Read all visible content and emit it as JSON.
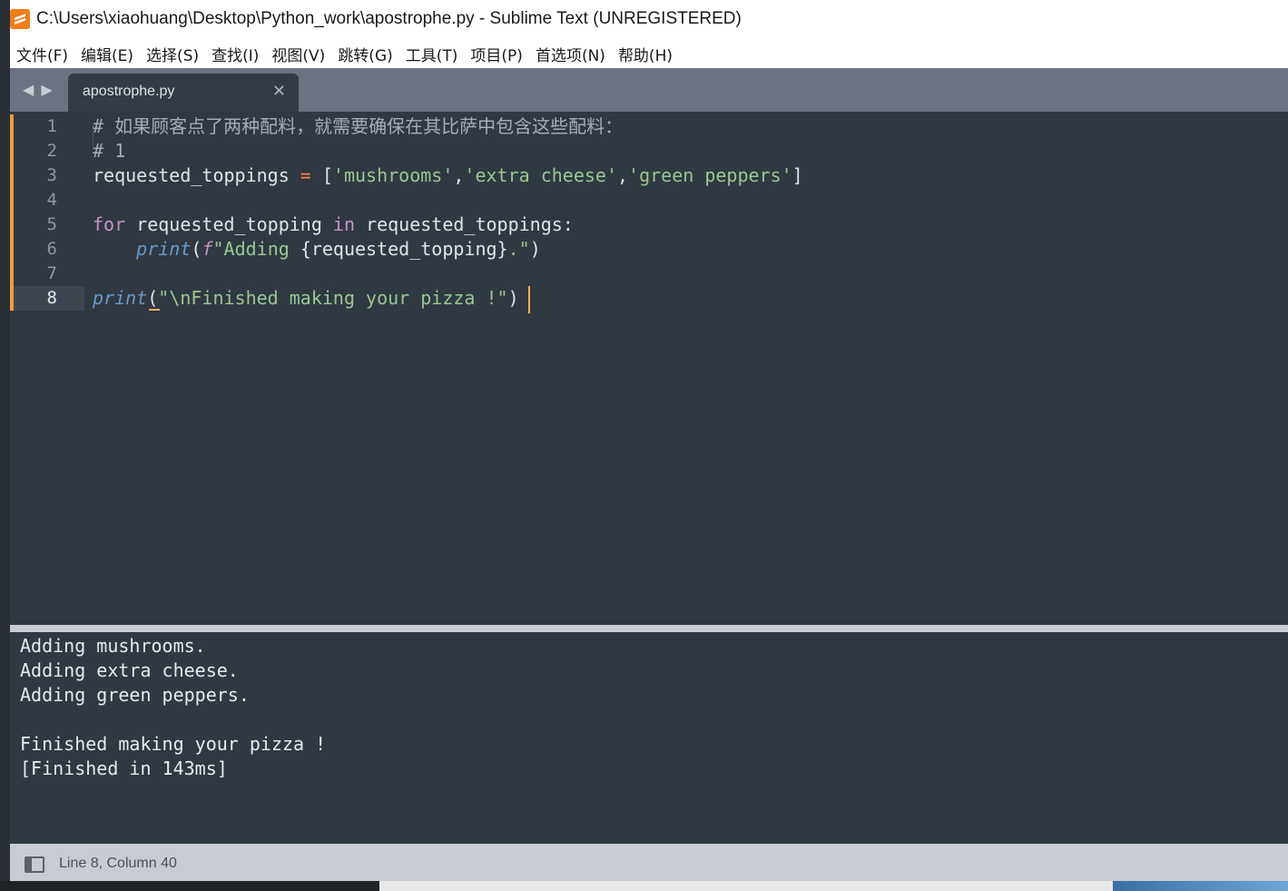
{
  "window": {
    "title": "C:\\Users\\xiaohuang\\Desktop\\Python_work\\apostrophe.py - Sublime Text (UNREGISTERED)"
  },
  "menu": {
    "items": [
      {
        "label": "文件(F)"
      },
      {
        "label": "编辑(E)"
      },
      {
        "label": "选择(S)"
      },
      {
        "label": "查找(I)"
      },
      {
        "label": "视图(V)"
      },
      {
        "label": "跳转(G)"
      },
      {
        "label": "工具(T)"
      },
      {
        "label": "项目(P)"
      },
      {
        "label": "首选项(N)"
      },
      {
        "label": "帮助(H)"
      }
    ]
  },
  "tabs": {
    "nav_left": "◀",
    "nav_right": "▶",
    "active": {
      "label": "apostrophe.py",
      "close": "✕"
    }
  },
  "editor": {
    "line_numbers": [
      "1",
      "2",
      "3",
      "4",
      "5",
      "6",
      "7",
      "8"
    ],
    "active_line": "8",
    "lines": {
      "l1": "# 如果顾客点了两种配料，就需要确保在其比萨中包含这些配料：",
      "l2": "# 1",
      "l3_var": "requested_toppings ",
      "l3_eq": "=",
      "l3_open": " [",
      "l3_s1": "'mushrooms'",
      "l3_c1": ",",
      "l3_s2": "'extra cheese'",
      "l3_c2": ",",
      "l3_s3": "'green peppers'",
      "l3_close": "]",
      "l5_for": "for",
      "l5_mid": " requested_topping ",
      "l5_in": "in",
      "l5_end": " requested_toppings:",
      "l6_indent": "    ",
      "l6_print": "print",
      "l6_open": "(",
      "l6_f": "f",
      "l6_str1": "\"Adding ",
      "l6_expr": "{requested_topping}",
      "l6_str2": ".\"",
      "l6_close": ")",
      "l8_print": "print",
      "l8_open": "(",
      "l8_str": "\"\\nFinished making your pizza !\"",
      "l8_close": ")"
    }
  },
  "output": {
    "lines": [
      "Adding mushrooms.",
      "Adding extra cheese.",
      "Adding green peppers.",
      "",
      "Finished making your pizza !",
      "[Finished in 143ms]"
    ]
  },
  "status": {
    "position": "Line 8, Column 40"
  },
  "colors": {
    "editor_bg": "#303841",
    "string": "#99c794",
    "keyword": "#c594c5",
    "function": "#6699cc",
    "operator": "#f97b58",
    "accent": "#f9ae58"
  }
}
